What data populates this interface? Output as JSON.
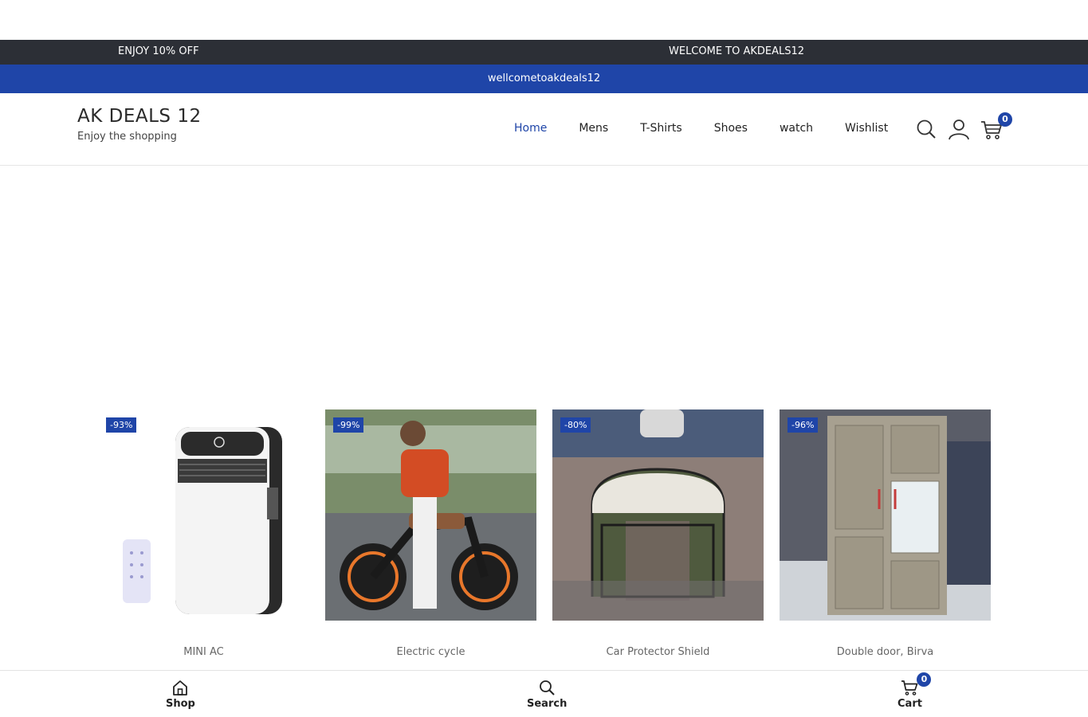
{
  "topbar": {
    "left_text": "ENJOY 10% OFF",
    "right_text": "WELCOME TO AKDEALS12"
  },
  "announcement": "wellcometoakdeals12",
  "brand": {
    "title": "AK DEALS 12",
    "tagline": "Enjoy the shopping"
  },
  "nav": {
    "items": [
      "Home",
      "Mens",
      "T-Shirts",
      "Shoes",
      "watch",
      "Wishlist"
    ],
    "active": "Home"
  },
  "header_icons": {
    "cart_count": "0"
  },
  "products": [
    {
      "name": "MINI AC",
      "discount": "-93%"
    },
    {
      "name": "Electric cycle",
      "discount": "-99%"
    },
    {
      "name": "Car Protector Shield",
      "discount": "-80%"
    },
    {
      "name": "Double door, Birva",
      "discount": "-96%"
    }
  ],
  "bottom_bar": {
    "shop_label": "Shop",
    "search_label": "Search",
    "cart_label": "Cart",
    "cart_count": "0"
  },
  "colors": {
    "accent": "#1f45a8",
    "topbar": "#2c2f36"
  }
}
